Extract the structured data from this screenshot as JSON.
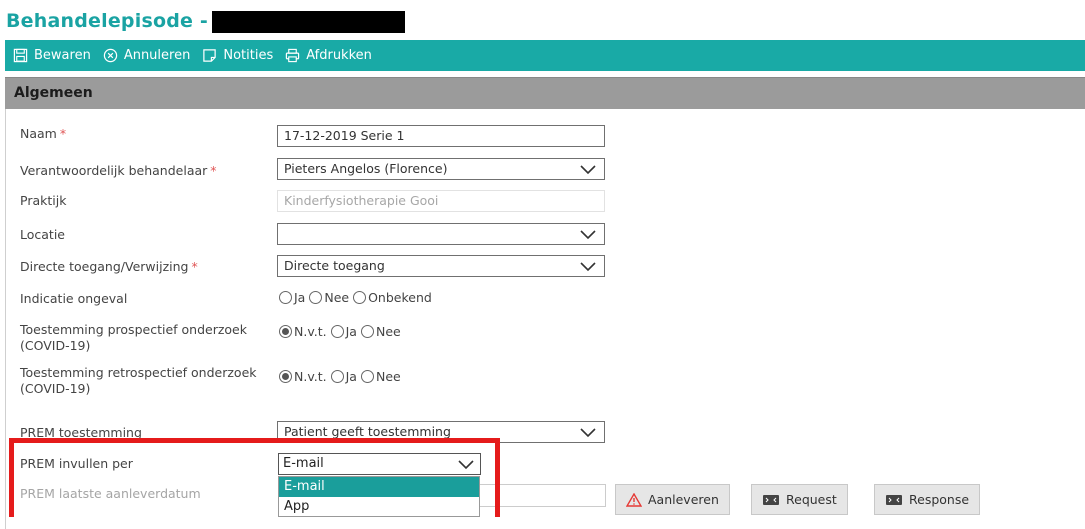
{
  "header": {
    "title": "Behandelepisode -"
  },
  "toolbar": {
    "items": [
      {
        "label": "Bewaren",
        "icon": "save-icon"
      },
      {
        "label": "Annuleren",
        "icon": "cancel-icon"
      },
      {
        "label": "Notities",
        "icon": "notes-icon"
      },
      {
        "label": "Afdrukken",
        "icon": "print-icon"
      }
    ]
  },
  "section": {
    "title": "Algemeen"
  },
  "form": {
    "naam": {
      "label": "Naam",
      "value": "17-12-2019 Serie 1"
    },
    "behandelaar": {
      "label": "Verantwoordelijk behandelaar",
      "value": "Pieters Angelos (Florence)"
    },
    "praktijk": {
      "label": "Praktijk",
      "value": "Kinderfysiotherapie Gooi"
    },
    "locatie": {
      "label": "Locatie",
      "value": ""
    },
    "toegang": {
      "label": "Directe toegang/Verwijzing",
      "value": "Directe toegang"
    },
    "ongeval": {
      "label": "Indicatie ongeval",
      "options": [
        "Ja",
        "Nee",
        "Onbekend"
      ],
      "selected": ""
    },
    "prospectief": {
      "label": "Toestemming prospectief onderzoek (COVID-19)",
      "options": [
        "N.v.t.",
        "Ja",
        "Nee"
      ],
      "selected": "N.v.t."
    },
    "retrospectief": {
      "label": "Toestemming retrospectief onderzoek (COVID-19)",
      "options": [
        "N.v.t.",
        "Ja",
        "Nee"
      ],
      "selected": "N.v.t."
    },
    "prem_toestemming": {
      "label": "PREM toestemming",
      "value": "Patient geeft toestemming"
    },
    "prem_invullen": {
      "label": "PREM invullen per",
      "value": "E-mail",
      "options": [
        "E-mail",
        "App"
      ],
      "highlighted": "E-mail"
    },
    "prem_datum": {
      "label": "PREM laatste aanleverdatum"
    }
  },
  "buttons": {
    "aanleveren": "Aanleveren",
    "request": "Request",
    "response": "Response"
  },
  "colors": {
    "accent": "#19aaa6",
    "title": "#1aa3a3",
    "highlight": "#e51b1b",
    "section": "#9b9b9b"
  }
}
